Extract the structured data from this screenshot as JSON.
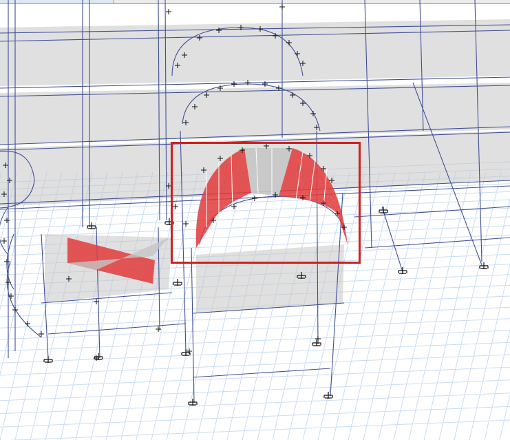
{
  "colors": {
    "background": "#ffffff",
    "grid": "#c9ddf2",
    "frame": "#3f4f97",
    "slab": "#c6c6c6",
    "selected_shell": "#e23b3b",
    "selection_box": "#d11f1f",
    "support": "#111111"
  },
  "icons": [
    "node-tick-icon",
    "pin-support-icon"
  ],
  "selection": {
    "state": "active",
    "shape": "barrel-vault-shell"
  }
}
